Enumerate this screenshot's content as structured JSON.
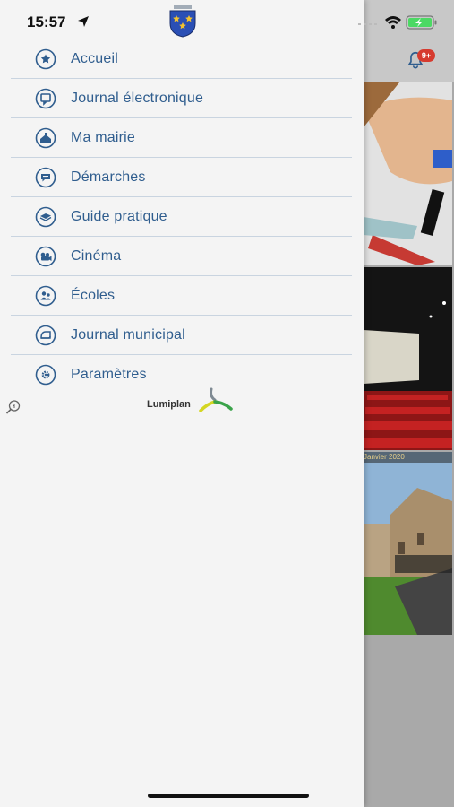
{
  "status_bar": {
    "time": "15:57"
  },
  "notifications": {
    "badge": "9+"
  },
  "menu": {
    "items": [
      {
        "label": "Accueil",
        "icon": "star-icon"
      },
      {
        "label": "Journal électronique",
        "icon": "screen-icon"
      },
      {
        "label": "Ma mairie",
        "icon": "town-hall-icon"
      },
      {
        "label": "Démarches",
        "icon": "chat-icon"
      },
      {
        "label": "Guide pratique",
        "icon": "guide-icon"
      },
      {
        "label": "Cinéma",
        "icon": "camera-icon"
      },
      {
        "label": "Écoles",
        "icon": "school-icon"
      },
      {
        "label": "Journal municipal",
        "icon": "newspaper-icon"
      },
      {
        "label": "Paramètres",
        "icon": "settings-icon"
      }
    ]
  },
  "brand": {
    "name": "Lumiplan"
  },
  "background": {
    "photo3_caption": "Janvier 2020"
  },
  "colors": {
    "accent": "#2f5d8e",
    "divider": "#c9d4e0",
    "drawer_bg": "#f4f4f4",
    "badge": "#d63b2f"
  }
}
